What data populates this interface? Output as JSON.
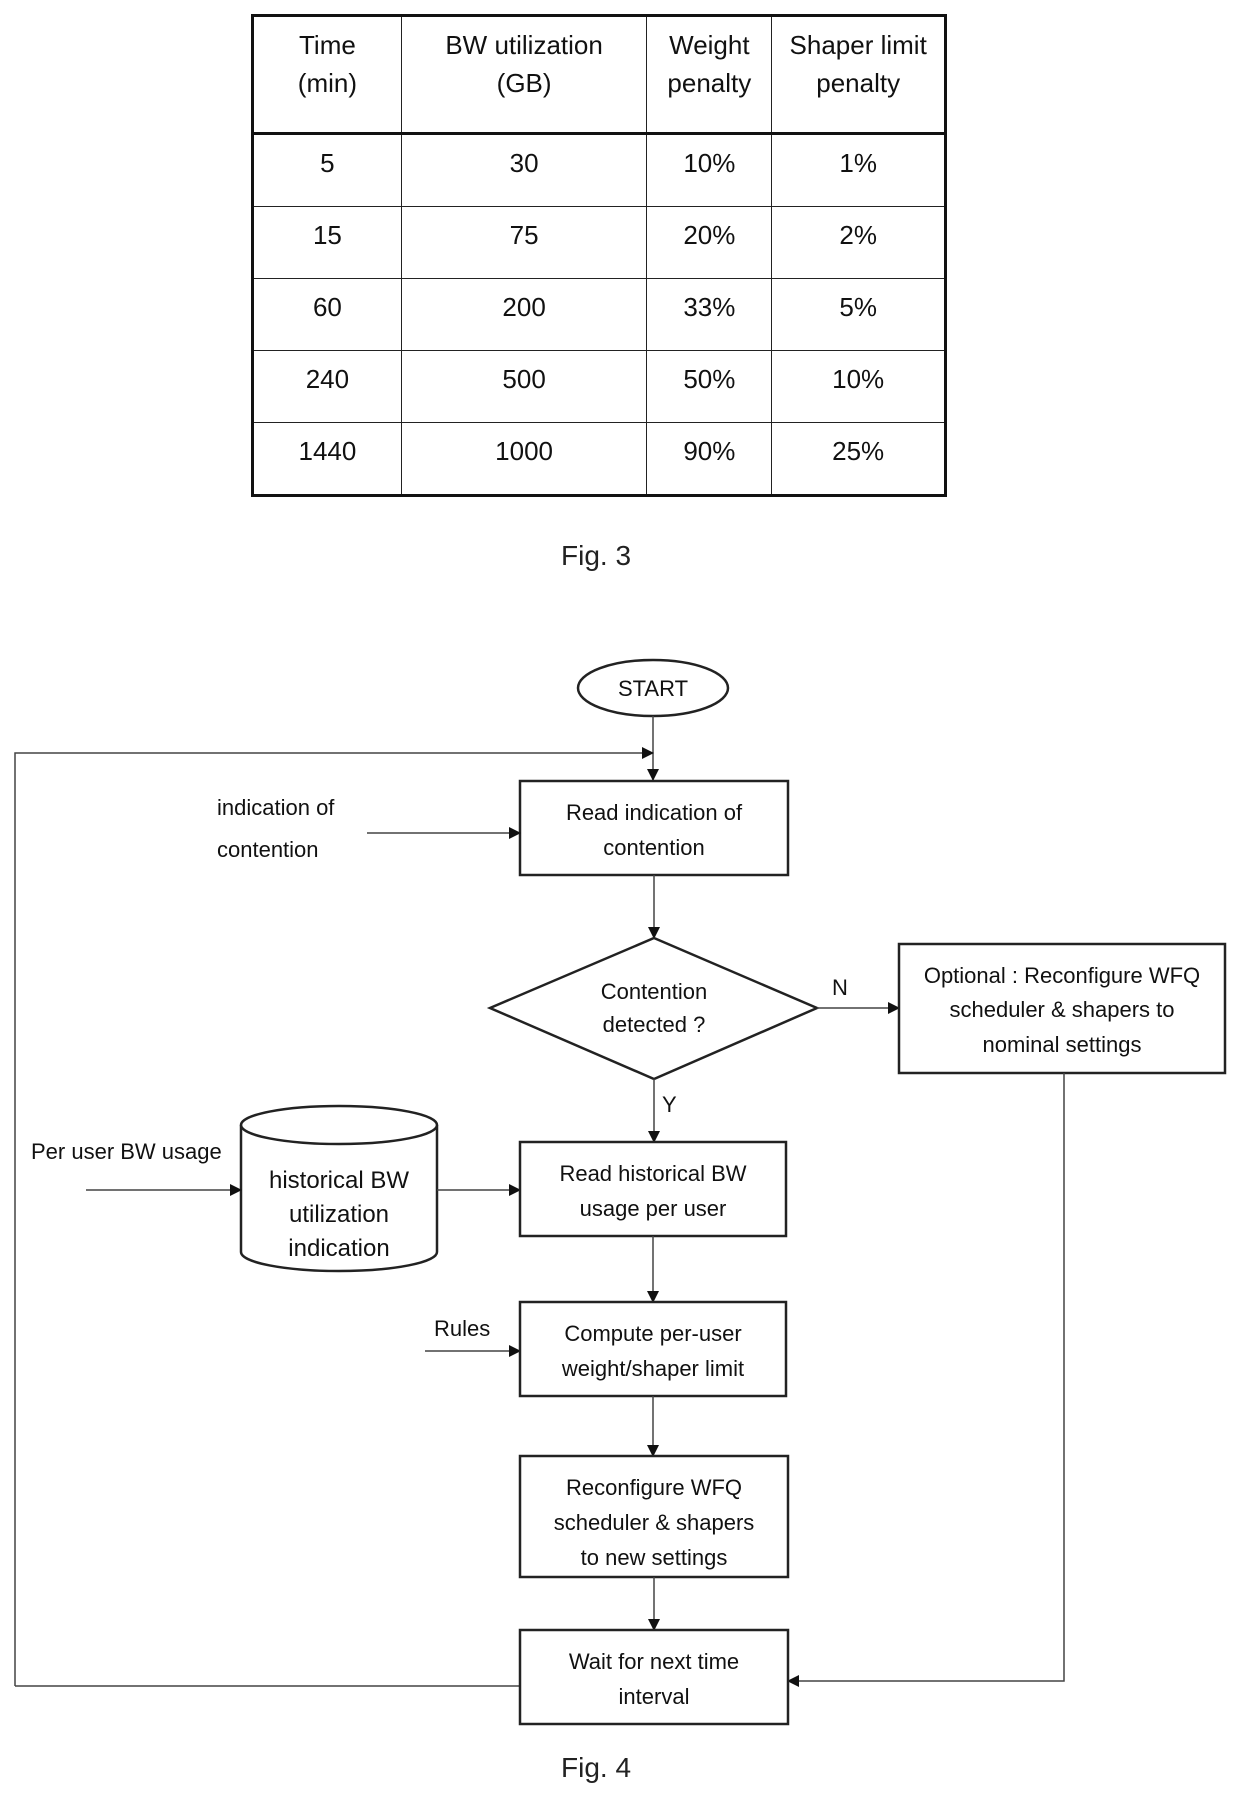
{
  "fig3": {
    "caption": "Fig. 3",
    "headers": [
      [
        "Time",
        "(min)"
      ],
      [
        "BW utilization",
        "(GB)"
      ],
      [
        "Weight",
        "penalty"
      ],
      [
        "Shaper limit",
        "penalty"
      ]
    ],
    "rows": [
      [
        "5",
        "30",
        "10%",
        "1%"
      ],
      [
        "15",
        "75",
        "20%",
        "2%"
      ],
      [
        "60",
        "200",
        "33%",
        "5%"
      ],
      [
        "240",
        "500",
        "50%",
        "10%"
      ],
      [
        "1440",
        "1000",
        "90%",
        "25%"
      ]
    ]
  },
  "fig4": {
    "caption": "Fig. 4",
    "start": "START",
    "read_indication": [
      "Read indication of",
      "contention"
    ],
    "indication_input": [
      "indication of",
      "contention"
    ],
    "decision": [
      "Contention",
      "detected ?"
    ],
    "no_label": "N",
    "yes_label": "Y",
    "optional": [
      "Optional : Reconfigure WFQ",
      "scheduler & shapers to",
      "nominal settings"
    ],
    "per_user_input": "Per user BW usage",
    "database": [
      "historical BW",
      "utilization",
      "indication"
    ],
    "read_historical": [
      "Read historical BW",
      "usage per user"
    ],
    "rules_input": "Rules",
    "compute": [
      "Compute per-user",
      "weight/shaper limit"
    ],
    "reconfigure": [
      "Reconfigure WFQ",
      "scheduler & shapers",
      "to new settings"
    ],
    "wait": [
      "Wait for next time",
      "interval"
    ]
  }
}
